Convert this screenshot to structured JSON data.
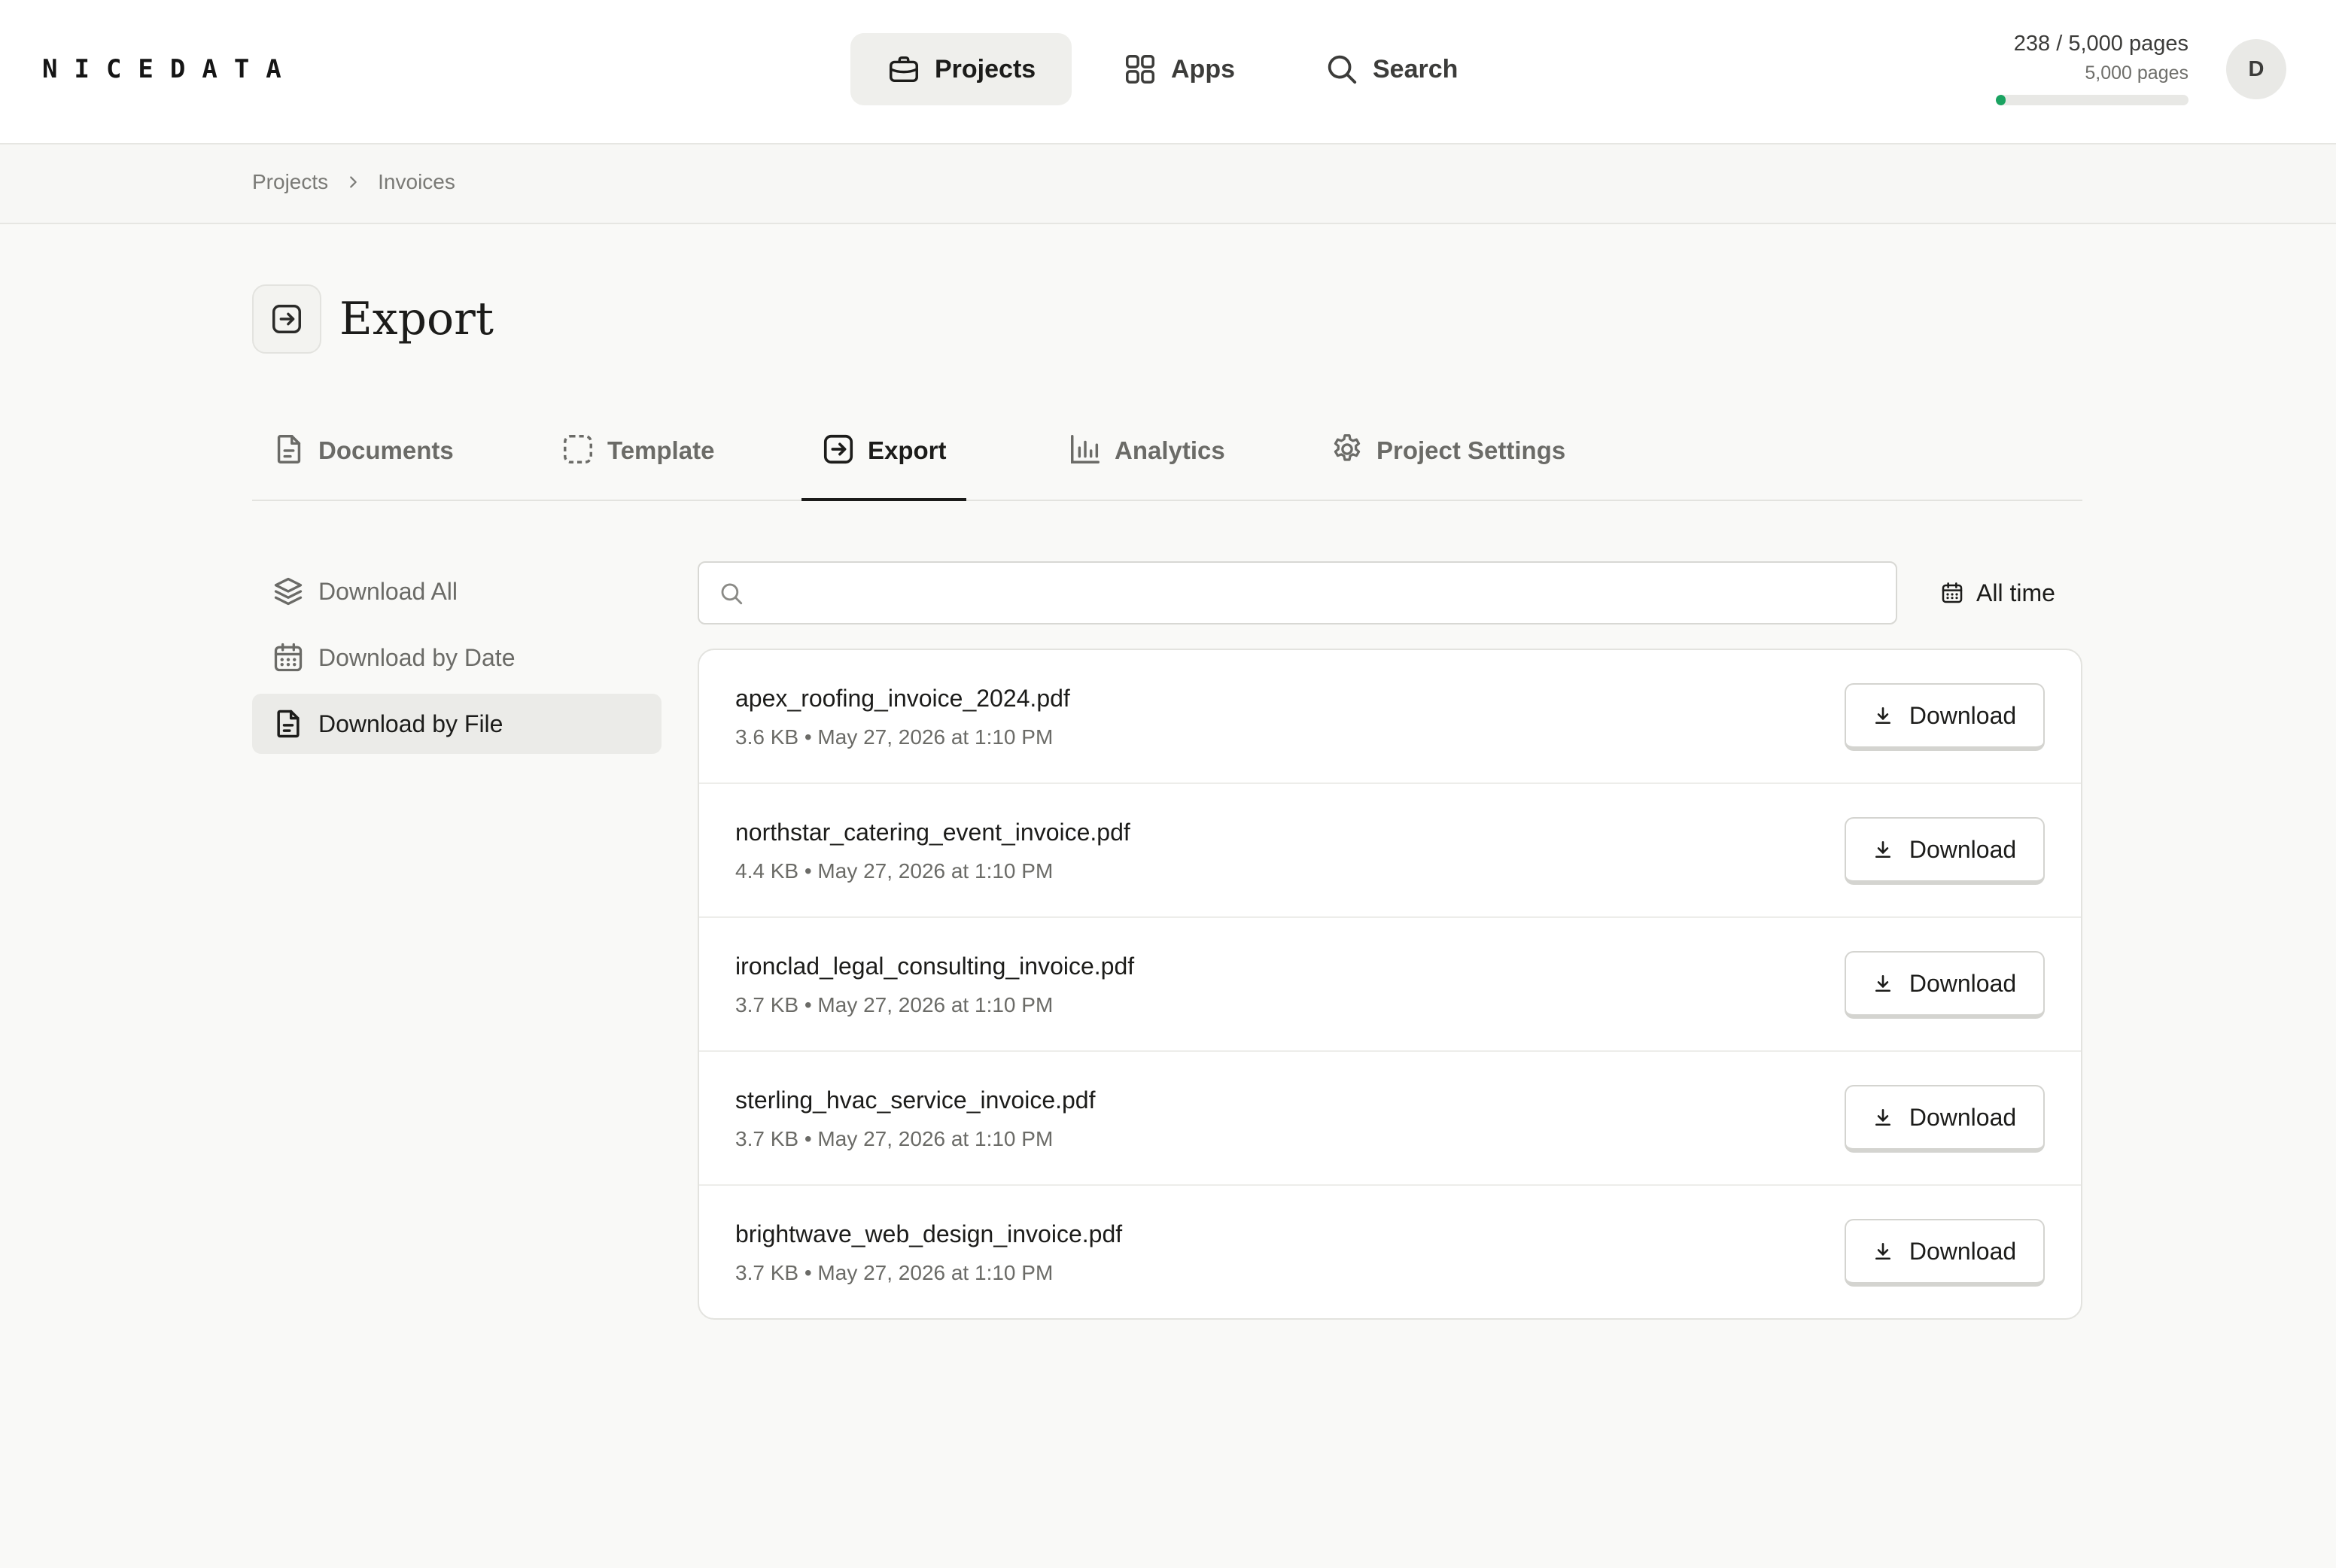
{
  "header": {
    "logo": "NICEDATA",
    "nav": [
      {
        "label": "Projects",
        "icon": "briefcase-icon",
        "active": true
      },
      {
        "label": "Apps",
        "icon": "grid-icon",
        "active": false
      },
      {
        "label": "Search",
        "icon": "search-icon",
        "active": false
      }
    ],
    "usage": {
      "used_label": "238 / 5,000 pages",
      "limit_label": "5,000 pages",
      "progress_fraction": 0.0476
    },
    "avatar_initial": "D"
  },
  "breadcrumb": {
    "items": [
      "Projects",
      "Invoices"
    ]
  },
  "page": {
    "title": "Export",
    "icon": "export-icon"
  },
  "tabs": [
    {
      "label": "Documents",
      "icon": "document-icon",
      "active": false
    },
    {
      "label": "Template",
      "icon": "dashed-square-icon",
      "active": false
    },
    {
      "label": "Export",
      "icon": "export-icon",
      "active": true
    },
    {
      "label": "Analytics",
      "icon": "bar-chart-icon",
      "active": false
    },
    {
      "label": "Project Settings",
      "icon": "gear-icon",
      "active": false
    }
  ],
  "sidebar": {
    "items": [
      {
        "label": "Download All",
        "icon": "layers-icon",
        "active": false
      },
      {
        "label": "Download by Date",
        "icon": "calendar-icon",
        "active": false
      },
      {
        "label": "Download by File",
        "icon": "file-icon",
        "active": true
      }
    ]
  },
  "search": {
    "placeholder": "",
    "value": ""
  },
  "filter": {
    "label": "All time",
    "icon": "calendar-icon"
  },
  "files": [
    {
      "name": "apex_roofing_invoice_2024.pdf",
      "meta": "3.6 KB • May 27, 2026 at 1:10 PM",
      "button": "Download"
    },
    {
      "name": "northstar_catering_event_invoice.pdf",
      "meta": "4.4 KB • May 27, 2026 at 1:10 PM",
      "button": "Download"
    },
    {
      "name": "ironclad_legal_consulting_invoice.pdf",
      "meta": "3.7 KB • May 27, 2026 at 1:10 PM",
      "button": "Download"
    },
    {
      "name": "sterling_hvac_service_invoice.pdf",
      "meta": "3.7 KB • May 27, 2026 at 1:10 PM",
      "button": "Download"
    },
    {
      "name": "brightwave_web_design_invoice.pdf",
      "meta": "3.7 KB • May 27, 2026 at 1:10 PM",
      "button": "Download"
    }
  ],
  "colors": {
    "accent": "#1aa361",
    "active_text": "#1c1c1a",
    "muted_text": "#6b6b67"
  }
}
